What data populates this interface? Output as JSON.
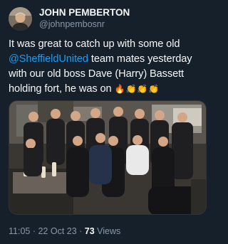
{
  "colors": {
    "background": "#15202b",
    "accent": "#1d9bf0",
    "muted": "#8b98a5"
  },
  "author": {
    "display_name": "JOHN PEMBERTON",
    "handle": "@johnpembosnr",
    "avatar_icon": "avatar-photo"
  },
  "tweet": {
    "text_before": "It was great to catch up with some old ",
    "mention": "@SheffieldUnited",
    "text_after": " team mates yesterday with our old boss Dave (Harry) Bassett holding fort, he was on ",
    "emojis": "🔥👏👏👏",
    "photo_icon": "group-photo"
  },
  "meta": {
    "time": "11:05",
    "separator": " · ",
    "date": "22 Oct 23",
    "views_count": "73",
    "views_label": " Views"
  }
}
